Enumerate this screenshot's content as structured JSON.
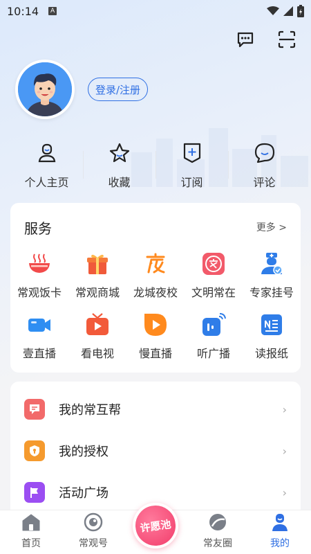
{
  "status_bar": {
    "time": "10:14",
    "notification_badge": "A"
  },
  "profile": {
    "login_label": "登录/注册"
  },
  "quick_links": [
    {
      "label": "个人主页",
      "icon": "user-icon"
    },
    {
      "label": "收藏",
      "icon": "star-icon"
    },
    {
      "label": "订阅",
      "icon": "subscribe-icon"
    },
    {
      "label": "评论",
      "icon": "comment-icon"
    }
  ],
  "services": {
    "title": "服务",
    "more_label": "更多 >",
    "items": [
      {
        "label": "常观饭卡",
        "icon": "bowl-icon",
        "color": "#f24a4a"
      },
      {
        "label": "常观商城",
        "icon": "gift-icon",
        "color": "#f05a3a"
      },
      {
        "label": "龙城夜校",
        "icon": "night-school-icon",
        "color": "#ff8a1e"
      },
      {
        "label": "文明常在",
        "icon": "civilization-icon",
        "color": "#f25a6a"
      },
      {
        "label": "专家挂号",
        "icon": "doctor-icon",
        "color": "#2f7de8"
      },
      {
        "label": "壹直播",
        "icon": "live-video-icon",
        "color": "#2f8ef2"
      },
      {
        "label": "看电视",
        "icon": "tv-icon",
        "color": "#f25a3a"
      },
      {
        "label": "慢直播",
        "icon": "slow-live-icon",
        "color": "#ff8a1e"
      },
      {
        "label": "听广播",
        "icon": "radio-icon",
        "color": "#2f7de8"
      },
      {
        "label": "读报纸",
        "icon": "newspaper-icon",
        "color": "#2f7de8"
      }
    ]
  },
  "menu": [
    {
      "label": "我的常互帮",
      "icon": "help-icon",
      "color": "#f26a6a",
      "arrow": "›"
    },
    {
      "label": "我的授权",
      "icon": "authorize-icon",
      "color": "#f59a2e",
      "arrow": "›"
    },
    {
      "label": "活动广场",
      "icon": "flag-icon",
      "color": "#9b4ef2",
      "arrow": "›"
    }
  ],
  "tabbar": {
    "tabs": [
      {
        "label": "首页",
        "icon": "home-icon"
      },
      {
        "label": "常观号",
        "icon": "channel-icon"
      },
      {
        "label": "常友圈",
        "icon": "circle-icon"
      },
      {
        "label": "我的",
        "icon": "profile-icon"
      }
    ],
    "wish_label": "许愿池",
    "active_tab": "我的"
  },
  "colors": {
    "accent": "#2f6fe3",
    "wish": "#f23d6b"
  }
}
